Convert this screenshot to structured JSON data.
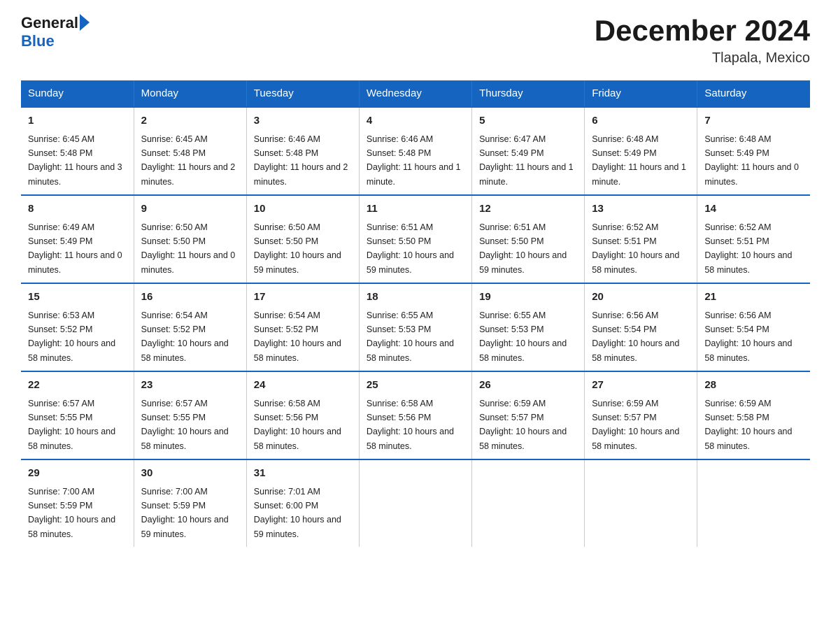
{
  "logo": {
    "text_general": "General",
    "text_blue": "Blue",
    "arrow_color": "#1565c0"
  },
  "title": "December 2024",
  "subtitle": "Tlapala, Mexico",
  "header_color": "#1565c0",
  "days_of_week": [
    "Sunday",
    "Monday",
    "Tuesday",
    "Wednesday",
    "Thursday",
    "Friday",
    "Saturday"
  ],
  "weeks": [
    [
      {
        "day": "1",
        "sunrise": "6:45 AM",
        "sunset": "5:48 PM",
        "daylight": "11 hours and 3 minutes."
      },
      {
        "day": "2",
        "sunrise": "6:45 AM",
        "sunset": "5:48 PM",
        "daylight": "11 hours and 2 minutes."
      },
      {
        "day": "3",
        "sunrise": "6:46 AM",
        "sunset": "5:48 PM",
        "daylight": "11 hours and 2 minutes."
      },
      {
        "day": "4",
        "sunrise": "6:46 AM",
        "sunset": "5:48 PM",
        "daylight": "11 hours and 1 minute."
      },
      {
        "day": "5",
        "sunrise": "6:47 AM",
        "sunset": "5:49 PM",
        "daylight": "11 hours and 1 minute."
      },
      {
        "day": "6",
        "sunrise": "6:48 AM",
        "sunset": "5:49 PM",
        "daylight": "11 hours and 1 minute."
      },
      {
        "day": "7",
        "sunrise": "6:48 AM",
        "sunset": "5:49 PM",
        "daylight": "11 hours and 0 minutes."
      }
    ],
    [
      {
        "day": "8",
        "sunrise": "6:49 AM",
        "sunset": "5:49 PM",
        "daylight": "11 hours and 0 minutes."
      },
      {
        "day": "9",
        "sunrise": "6:50 AM",
        "sunset": "5:50 PM",
        "daylight": "11 hours and 0 minutes."
      },
      {
        "day": "10",
        "sunrise": "6:50 AM",
        "sunset": "5:50 PM",
        "daylight": "10 hours and 59 minutes."
      },
      {
        "day": "11",
        "sunrise": "6:51 AM",
        "sunset": "5:50 PM",
        "daylight": "10 hours and 59 minutes."
      },
      {
        "day": "12",
        "sunrise": "6:51 AM",
        "sunset": "5:50 PM",
        "daylight": "10 hours and 59 minutes."
      },
      {
        "day": "13",
        "sunrise": "6:52 AM",
        "sunset": "5:51 PM",
        "daylight": "10 hours and 58 minutes."
      },
      {
        "day": "14",
        "sunrise": "6:52 AM",
        "sunset": "5:51 PM",
        "daylight": "10 hours and 58 minutes."
      }
    ],
    [
      {
        "day": "15",
        "sunrise": "6:53 AM",
        "sunset": "5:52 PM",
        "daylight": "10 hours and 58 minutes."
      },
      {
        "day": "16",
        "sunrise": "6:54 AM",
        "sunset": "5:52 PM",
        "daylight": "10 hours and 58 minutes."
      },
      {
        "day": "17",
        "sunrise": "6:54 AM",
        "sunset": "5:52 PM",
        "daylight": "10 hours and 58 minutes."
      },
      {
        "day": "18",
        "sunrise": "6:55 AM",
        "sunset": "5:53 PM",
        "daylight": "10 hours and 58 minutes."
      },
      {
        "day": "19",
        "sunrise": "6:55 AM",
        "sunset": "5:53 PM",
        "daylight": "10 hours and 58 minutes."
      },
      {
        "day": "20",
        "sunrise": "6:56 AM",
        "sunset": "5:54 PM",
        "daylight": "10 hours and 58 minutes."
      },
      {
        "day": "21",
        "sunrise": "6:56 AM",
        "sunset": "5:54 PM",
        "daylight": "10 hours and 58 minutes."
      }
    ],
    [
      {
        "day": "22",
        "sunrise": "6:57 AM",
        "sunset": "5:55 PM",
        "daylight": "10 hours and 58 minutes."
      },
      {
        "day": "23",
        "sunrise": "6:57 AM",
        "sunset": "5:55 PM",
        "daylight": "10 hours and 58 minutes."
      },
      {
        "day": "24",
        "sunrise": "6:58 AM",
        "sunset": "5:56 PM",
        "daylight": "10 hours and 58 minutes."
      },
      {
        "day": "25",
        "sunrise": "6:58 AM",
        "sunset": "5:56 PM",
        "daylight": "10 hours and 58 minutes."
      },
      {
        "day": "26",
        "sunrise": "6:59 AM",
        "sunset": "5:57 PM",
        "daylight": "10 hours and 58 minutes."
      },
      {
        "day": "27",
        "sunrise": "6:59 AM",
        "sunset": "5:57 PM",
        "daylight": "10 hours and 58 minutes."
      },
      {
        "day": "28",
        "sunrise": "6:59 AM",
        "sunset": "5:58 PM",
        "daylight": "10 hours and 58 minutes."
      }
    ],
    [
      {
        "day": "29",
        "sunrise": "7:00 AM",
        "sunset": "5:59 PM",
        "daylight": "10 hours and 58 minutes."
      },
      {
        "day": "30",
        "sunrise": "7:00 AM",
        "sunset": "5:59 PM",
        "daylight": "10 hours and 59 minutes."
      },
      {
        "day": "31",
        "sunrise": "7:01 AM",
        "sunset": "6:00 PM",
        "daylight": "10 hours and 59 minutes."
      },
      null,
      null,
      null,
      null
    ]
  ]
}
